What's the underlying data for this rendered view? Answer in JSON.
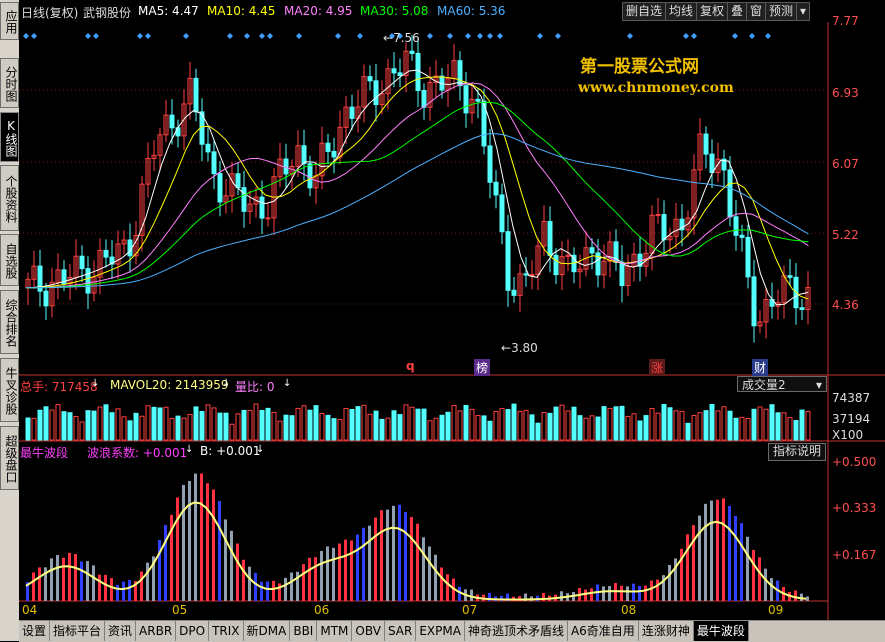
{
  "sidebar": [
    {
      "label": "应用",
      "active": false
    },
    {
      "label": "分时图",
      "active": false
    },
    {
      "label": "K线图",
      "active": true
    },
    {
      "label": "个股资料",
      "active": false
    },
    {
      "label": "自选股",
      "active": false
    },
    {
      "label": "综合排名",
      "active": false
    },
    {
      "label": "牛叉诊股",
      "active": false
    },
    {
      "label": "超级盘口",
      "active": false
    }
  ],
  "header": {
    "period": "日线(复权)",
    "stock": "武钢股份",
    "ma5": "MA5: 4.47",
    "ma10": "MA10: 4.45",
    "ma20": "MA20: 4.95",
    "ma30": "MA30: 5.08",
    "ma60": "MA60: 5.36",
    "buttons": [
      "删自选",
      "均线",
      "复权",
      "叠",
      "窗",
      "预测"
    ]
  },
  "watermark": {
    "title": "第一股票公式网",
    "url": "www.chnmoney.com"
  },
  "price_axis": [
    "7.77",
    "6.93",
    "6.07",
    "5.22",
    "4.36"
  ],
  "price_annotations": {
    "high": "7.56",
    "low": "3.80"
  },
  "event_markers": [
    "q",
    "榜",
    "涨",
    "财"
  ],
  "volume": {
    "label_total": "总手: 717458",
    "label_mavol": "MAVOL20: 2143959",
    "label_ratio": "量比: 0",
    "dropdown": "成交量2",
    "axis": [
      "74387",
      "37194",
      "X100"
    ]
  },
  "indicator": {
    "name": "最牛波段",
    "coef": "波浪系数: +0.001",
    "b": "B: +0.001",
    "help": "指标说明",
    "axis": [
      "+0.500",
      "+0.333",
      "+0.167"
    ]
  },
  "months": [
    "04",
    "05",
    "06",
    "07",
    "08",
    "09"
  ],
  "bottom_tabs": [
    "设置",
    "指标平台",
    "资讯",
    "ARBR",
    "DPO",
    "TRIX",
    "新DMA",
    "BBI",
    "MTM",
    "OBV",
    "SAR",
    "EXPMA",
    "神奇逃顶术矛盾线",
    "A6奇准自用",
    "连涨财神",
    "最牛波段"
  ],
  "bottom_tab_active": "最牛波段",
  "colors": {
    "up": "#ff4040",
    "down": "#54ffff",
    "ma5": "#ffffff",
    "ma10": "#ffff00",
    "ma20": "#ff80ff",
    "ma30": "#00ff00",
    "ma60": "#4cb0ff",
    "axis": "#c03030",
    "wave": "#ffff80"
  }
}
